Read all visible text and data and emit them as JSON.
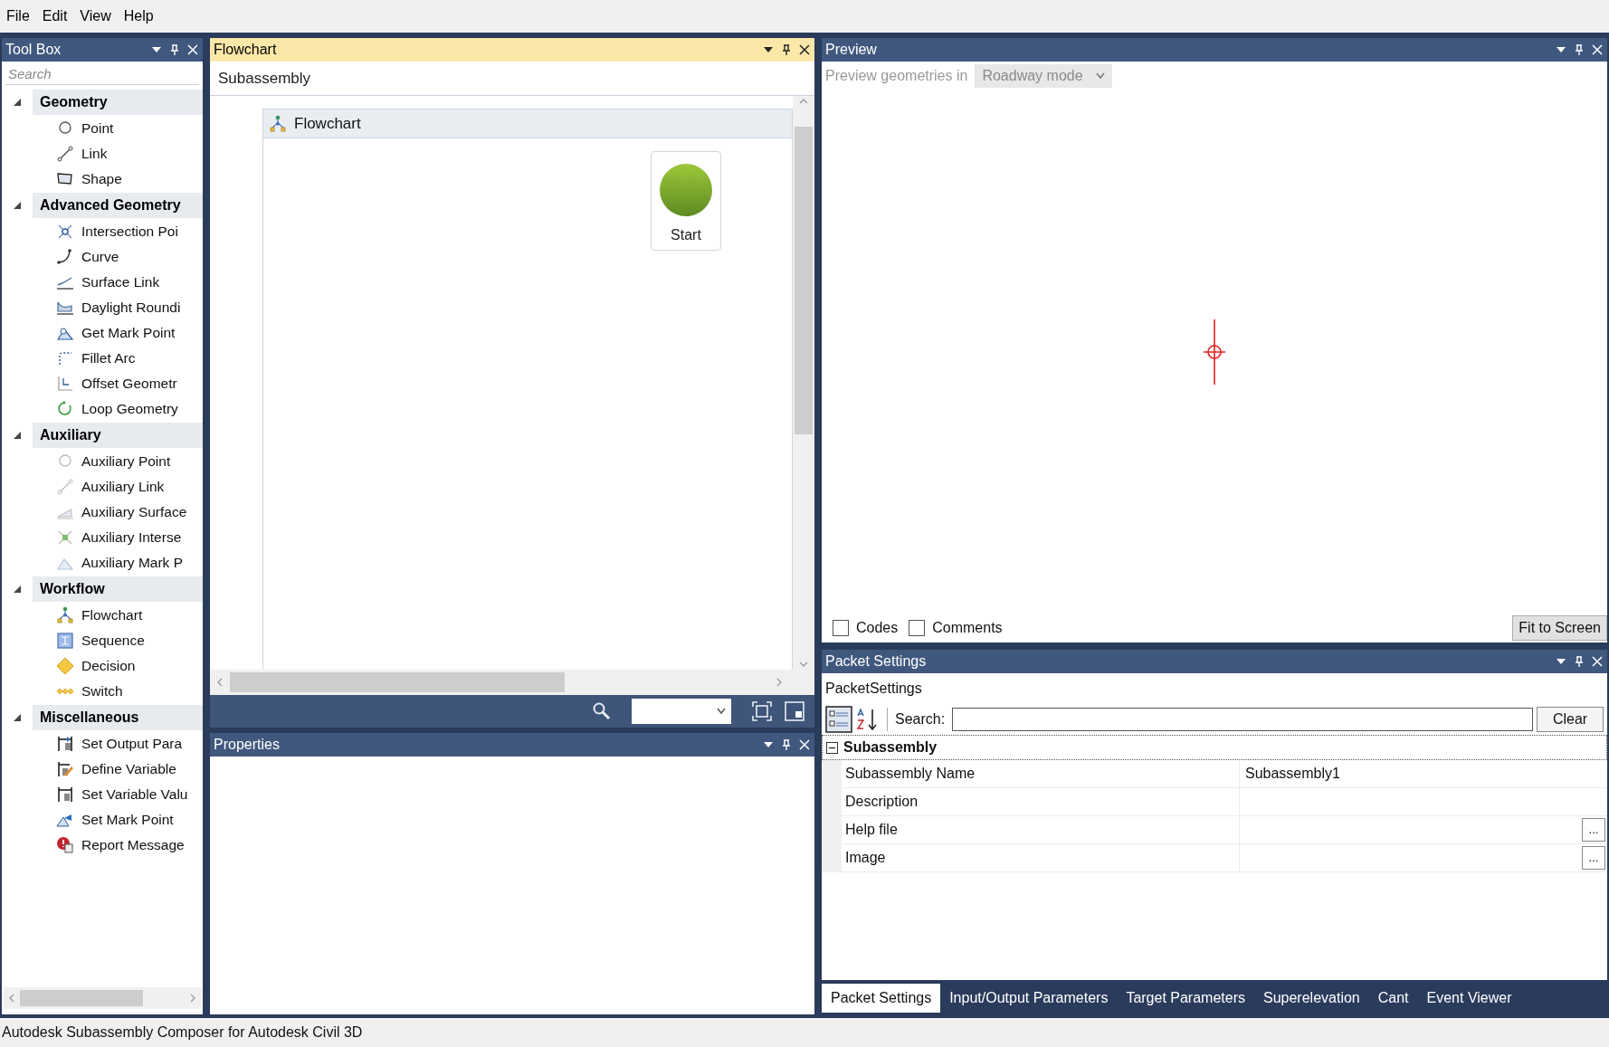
{
  "menu": [
    "File",
    "Edit",
    "View",
    "Help"
  ],
  "toolbox": {
    "title": "Tool Box",
    "active": false,
    "search": {
      "placeholder": "Search"
    },
    "groups": [
      {
        "label": "Geometry",
        "expanded": true,
        "items": [
          "Point",
          "Link",
          "Shape"
        ]
      },
      {
        "label": "Advanced Geometry",
        "expanded": true,
        "items": [
          "Intersection Poi",
          "Curve",
          "Surface Link",
          "Daylight Roundi",
          "Get Mark Point",
          "Fillet Arc",
          "Offset Geometr",
          "Loop Geometry"
        ]
      },
      {
        "label": "Auxiliary",
        "expanded": true,
        "items": [
          "Auxiliary Point",
          "Auxiliary Link",
          "Auxiliary Surface",
          "Auxiliary Interse",
          "Auxiliary Mark P"
        ]
      },
      {
        "label": "Workflow",
        "expanded": true,
        "items": [
          "Flowchart",
          "Sequence",
          "Decision",
          "Switch"
        ]
      },
      {
        "label": "Miscellaneous",
        "expanded": true,
        "items": [
          "Set Output Para",
          "Define Variable",
          "Set Variable Valu",
          "Set Mark Point",
          "Report Message"
        ]
      }
    ]
  },
  "flowchart": {
    "title": "Flowchart",
    "active": true,
    "breadcrumb": "Subassembly",
    "container": "Flowchart",
    "nodes": [
      {
        "label": "Start"
      }
    ]
  },
  "properties": {
    "title": "Properties",
    "active": false
  },
  "preview": {
    "title": "Preview",
    "active": false,
    "mode_label": "Preview geometries in",
    "mode": {
      "value": "Roadway mode",
      "disabled": true
    },
    "checkboxes": [
      {
        "label": "Codes",
        "checked": false
      },
      {
        "label": "Comments",
        "checked": false
      }
    ],
    "fit_button": "Fit to Screen"
  },
  "packet_settings": {
    "title": "Packet Settings",
    "active": false,
    "object": "PacketSettings",
    "search_label": "Search:",
    "clear_button": "Clear",
    "category": {
      "label": "Subassembly",
      "expanded": true,
      "rows": [
        {
          "kind": "text",
          "name": "Subassembly Name",
          "value": "Subassembly1"
        },
        {
          "kind": "text",
          "name": "Description"
        },
        {
          "kind": "browse",
          "name": "Help file",
          "button": "..."
        },
        {
          "kind": "browse",
          "name": "Image",
          "button": "..."
        }
      ]
    },
    "tabs": [
      {
        "label": "Packet Settings",
        "selected": true
      },
      {
        "label": "Input/Output Parameters",
        "selected": false
      },
      {
        "label": "Target Parameters",
        "selected": false
      },
      {
        "label": "Superelevation",
        "selected": false
      },
      {
        "label": "Cant",
        "selected": false
      },
      {
        "label": "Event Viewer",
        "selected": false
      }
    ]
  },
  "status_bar": "Autodesk Subassembly Composer for Autodesk Civil 3D"
}
